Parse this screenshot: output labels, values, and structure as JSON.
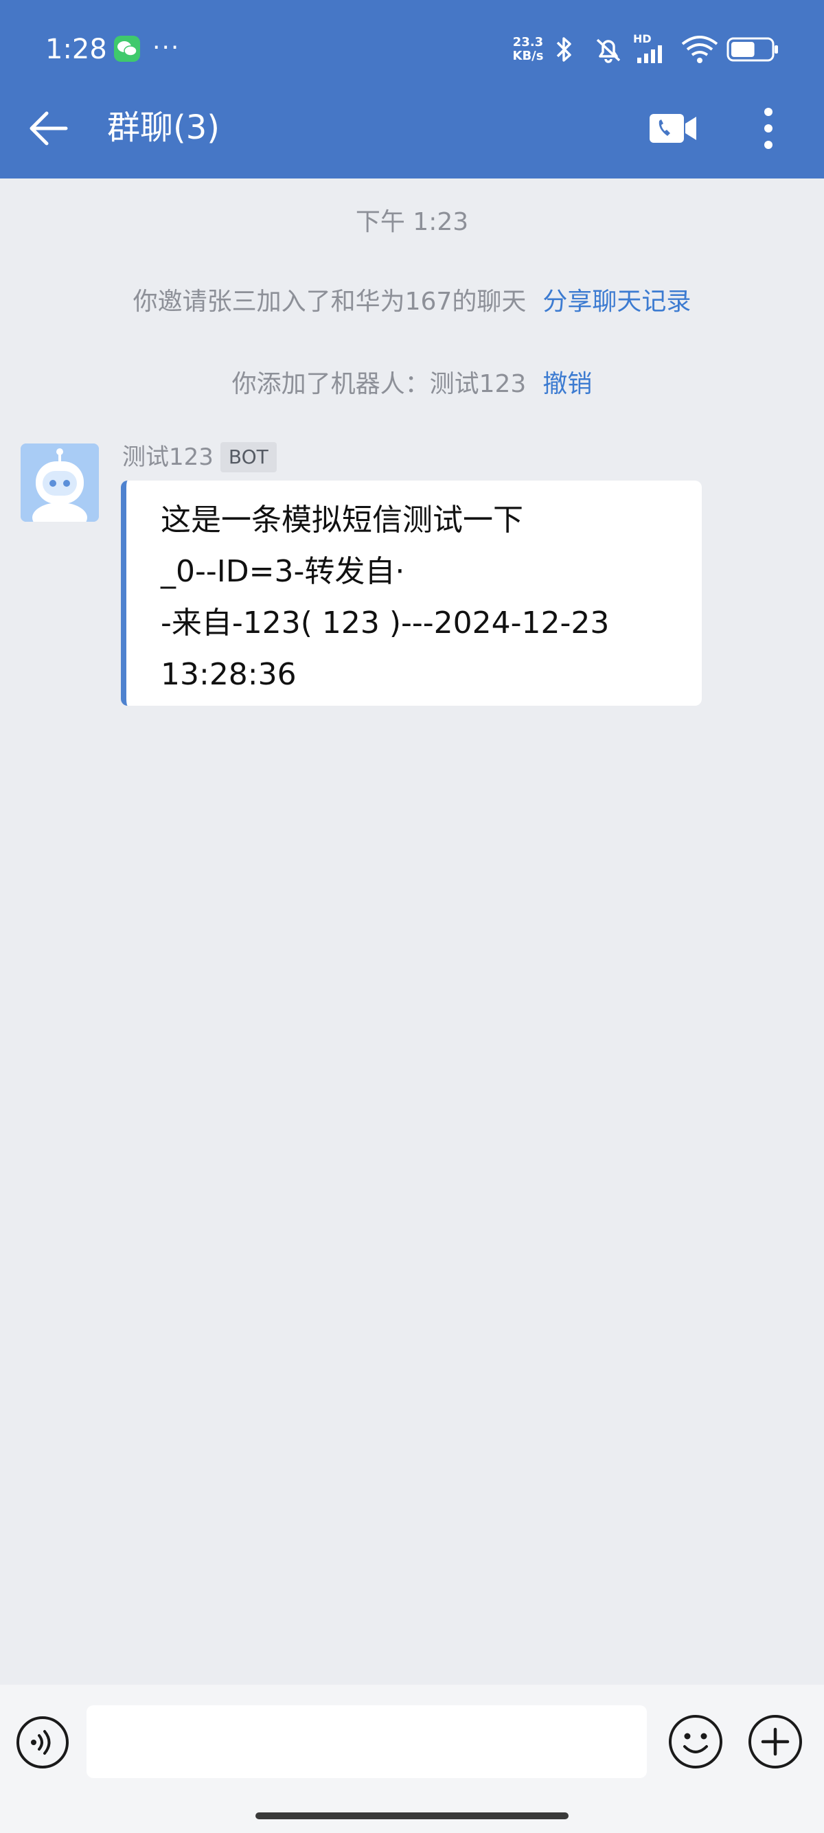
{
  "status_bar": {
    "time": "1:28",
    "more": "···",
    "net_speed_value": "23.3",
    "net_speed_unit": "KB/s",
    "signal_label": "HD",
    "wechat_icon": "wechat-icon",
    "bluetooth_icon": "bluetooth-icon",
    "mute_icon": "bell-muted-icon",
    "signal_icon": "cellular-signal-icon",
    "wifi_icon": "wifi-icon",
    "battery_icon": "battery-icon",
    "battery_level": 0.6
  },
  "header": {
    "title": "群聊(3)",
    "back_icon": "back-arrow-icon",
    "call_icon": "video-call-icon",
    "menu_icon": "more-vertical-icon"
  },
  "chat": {
    "timestamp": "下午 1:23",
    "system_invite_text": "你邀请张三加入了和华为167的聊天",
    "system_invite_link": "分享聊天记录",
    "system_robot_text": "你添加了机器人：测试123",
    "system_robot_link": "撤销",
    "message": {
      "sender": "测试123",
      "badge": "BOT",
      "avatar_icon": "robot-avatar-icon",
      "line1": "这是一条模拟短信测试一下",
      "line2": "_0--ID=3-转发自·",
      "line3": "-来自-123( 123 )---2024-12-23",
      "line4": "13:28:36"
    }
  },
  "input_bar": {
    "placeholder": "",
    "voice_icon": "voice-input-icon",
    "emoji_icon": "emoji-icon",
    "plus_icon": "plus-icon"
  },
  "colors": {
    "header_bg": "#4677c6",
    "page_bg": "#ebedf1",
    "link": "#3c7bd1",
    "bubble_accent": "#4e82cf"
  }
}
